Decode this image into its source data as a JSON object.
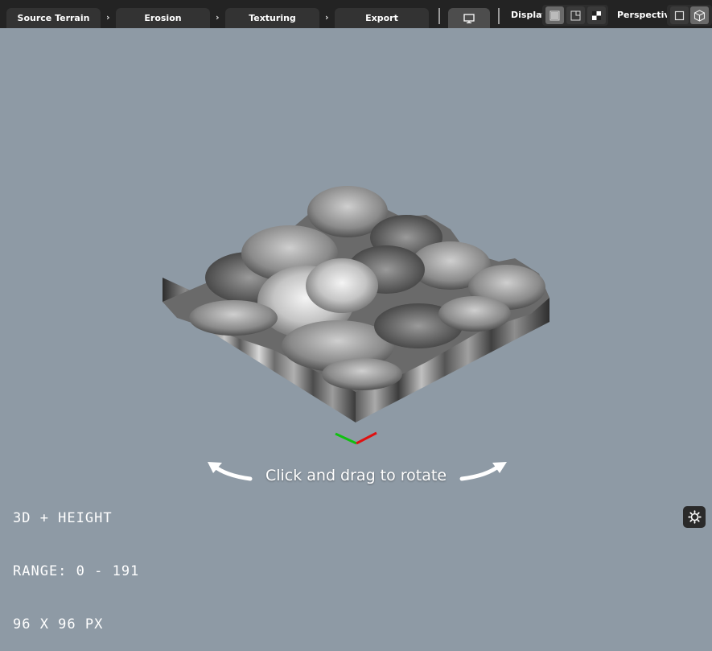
{
  "window": {
    "background": "#8e9aa5",
    "toolbar_color": "#232323"
  },
  "steps": [
    {
      "label": "Source Terrain"
    },
    {
      "label": "Erosion"
    },
    {
      "label": "Texturing"
    },
    {
      "label": "Export"
    }
  ],
  "chevron": "›",
  "preview_tab": {
    "icon": "monitor-icon"
  },
  "display": {
    "label": "Display",
    "options": [
      {
        "icon": "shaded-view-icon",
        "active": true
      },
      {
        "icon": "corner-view-icon",
        "active": false
      },
      {
        "icon": "checker-view-icon",
        "active": false
      }
    ]
  },
  "perspective": {
    "label": "Perspective",
    "options": [
      {
        "icon": "square-2d-icon",
        "active": false
      },
      {
        "icon": "cube-3d-icon",
        "active": true
      }
    ]
  },
  "viewport": {
    "hint": "Click and drag to rotate",
    "info": {
      "mode": "3D + HEIGHT",
      "range": "RANGE: 0 - 191",
      "size": "96 X 96 PX"
    },
    "axis_colors": {
      "x": "#e01010",
      "y": "#10c010"
    }
  },
  "settings": {
    "icon": "settings-gear-icon"
  }
}
